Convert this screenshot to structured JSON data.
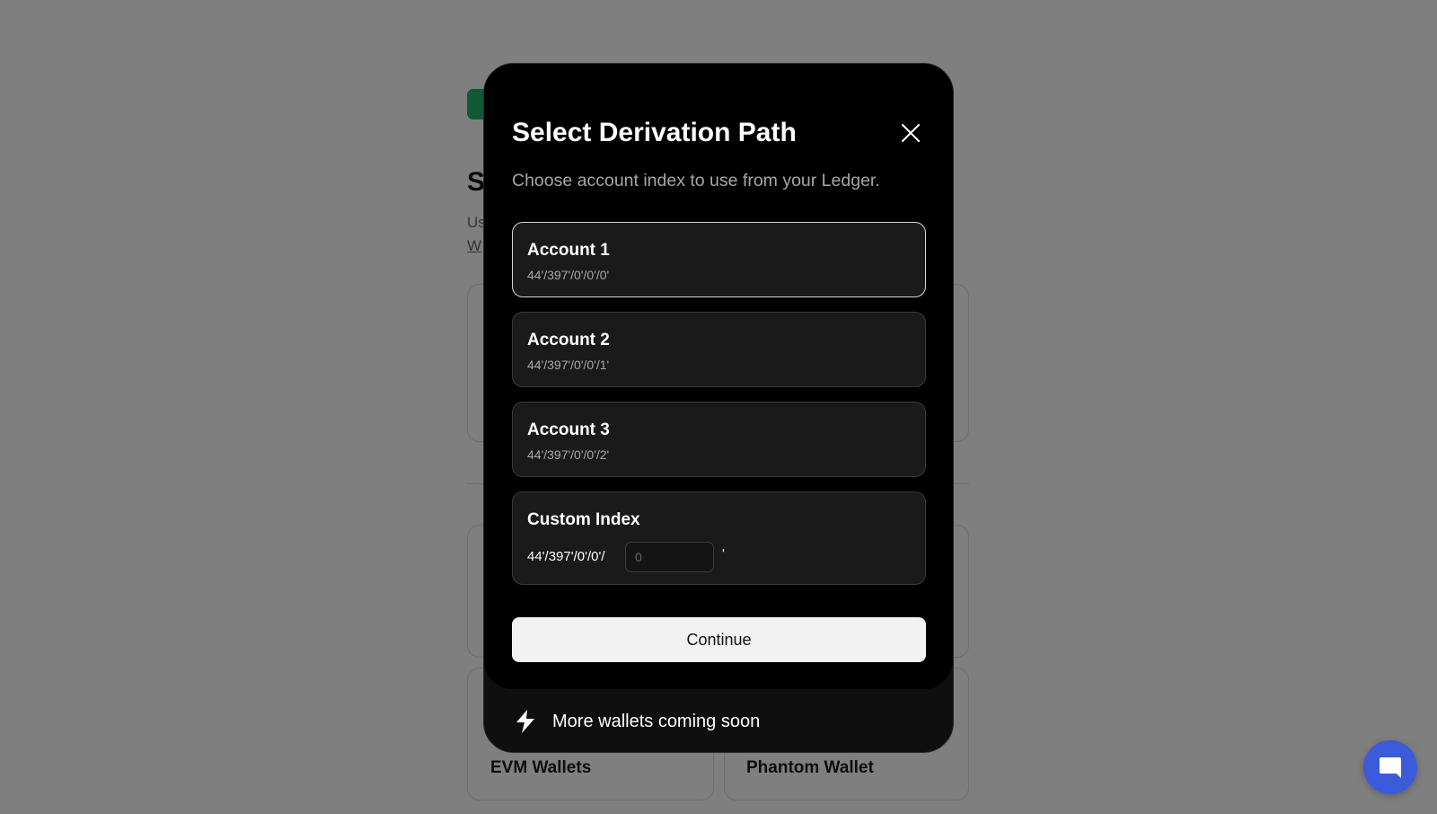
{
  "background": {
    "heading_initial": "S",
    "subtitle_line1": "Us",
    "subtitle_line2": "W",
    "cards": [
      {
        "label": "EVM Wallets"
      },
      {
        "label": "Phantom Wallet"
      }
    ]
  },
  "modal": {
    "title": "Select Derivation Path",
    "description": "Choose account index to use from your Ledger.",
    "accounts": [
      {
        "name": "Account 1",
        "path": "44'/397'/0'/0'/0'",
        "selected": true
      },
      {
        "name": "Account 2",
        "path": "44'/397'/0'/0'/1'",
        "selected": false
      },
      {
        "name": "Account 3",
        "path": "44'/397'/0'/0'/2'",
        "selected": false
      }
    ],
    "custom": {
      "title": "Custom Index",
      "prefix": "44'/397'/0'/0'/",
      "input_placeholder": "0",
      "suffix": "'"
    },
    "continue_label": "Continue",
    "footer_text": "More wallets coming soon"
  },
  "icons": {
    "close": "close-icon",
    "bolt": "lightning-bolt-icon",
    "chat": "chat-bubble-icon"
  },
  "colors": {
    "brand_green": "#1fb36b",
    "chat_blue": "#3b5bdb",
    "modal_bg": "#000000",
    "selected_border": "#d8d8d8"
  }
}
